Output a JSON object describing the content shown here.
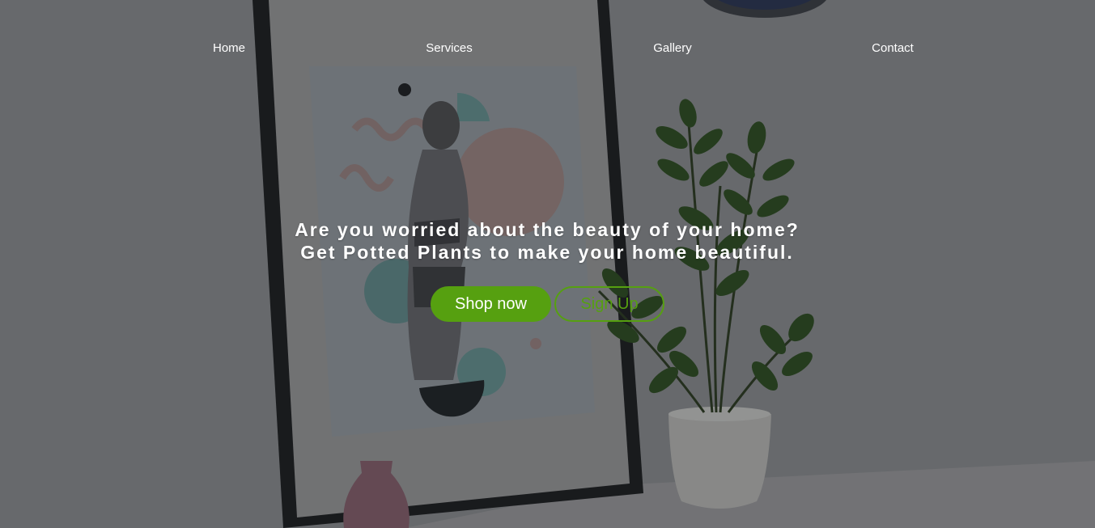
{
  "nav": {
    "items": [
      {
        "label": "Home"
      },
      {
        "label": "Services"
      },
      {
        "label": "Gallery"
      },
      {
        "label": "Contact"
      }
    ]
  },
  "hero": {
    "line1": "Are you worried about the beauty of your home?",
    "line2": "Get Potted Plants to make your home beautiful.",
    "primary_button": "Shop now",
    "secondary_button": "Sign Up"
  },
  "colors": {
    "accent": "#56a010",
    "overlay": "#7d7f83",
    "text": "#ffffff"
  }
}
